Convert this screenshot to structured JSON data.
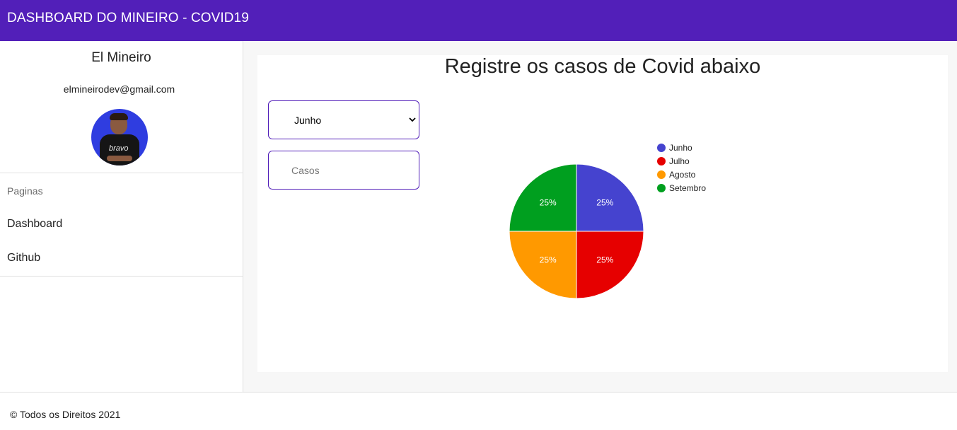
{
  "app": {
    "title": "DASHBOARD DO MINEIRO - COVID19"
  },
  "profile": {
    "name": "El Mineiro",
    "email": "elmineirodev@gmail.com",
    "avatar_shirt_text": "bravo"
  },
  "nav": {
    "section_label": "Paginas",
    "items": [
      {
        "label": "Dashboard"
      },
      {
        "label": "Github"
      }
    ]
  },
  "main": {
    "heading": "Registre os casos de Covid abaixo",
    "month_select": {
      "selected": "Junho",
      "options": [
        "Junho",
        "Julho",
        "Agosto",
        "Setembro"
      ]
    },
    "cases_input": {
      "placeholder": "Casos",
      "value": ""
    }
  },
  "chart_data": {
    "type": "pie",
    "categories": [
      "Junho",
      "Julho",
      "Agosto",
      "Setembro"
    ],
    "values": [
      25,
      25,
      25,
      25
    ],
    "labels": [
      "25%",
      "25%",
      "25%",
      "25%"
    ],
    "colors": [
      "#4543cf",
      "#e60000",
      "#ff9900",
      "#009f1f"
    ],
    "legend_position": "right"
  },
  "colors": {
    "header": "#521fb9",
    "accent_border": "#521fb9"
  },
  "icons": {
    "select_arrow": "chevron-down-icon"
  },
  "footer": {
    "text": "© Todos os Direitos 2021"
  }
}
